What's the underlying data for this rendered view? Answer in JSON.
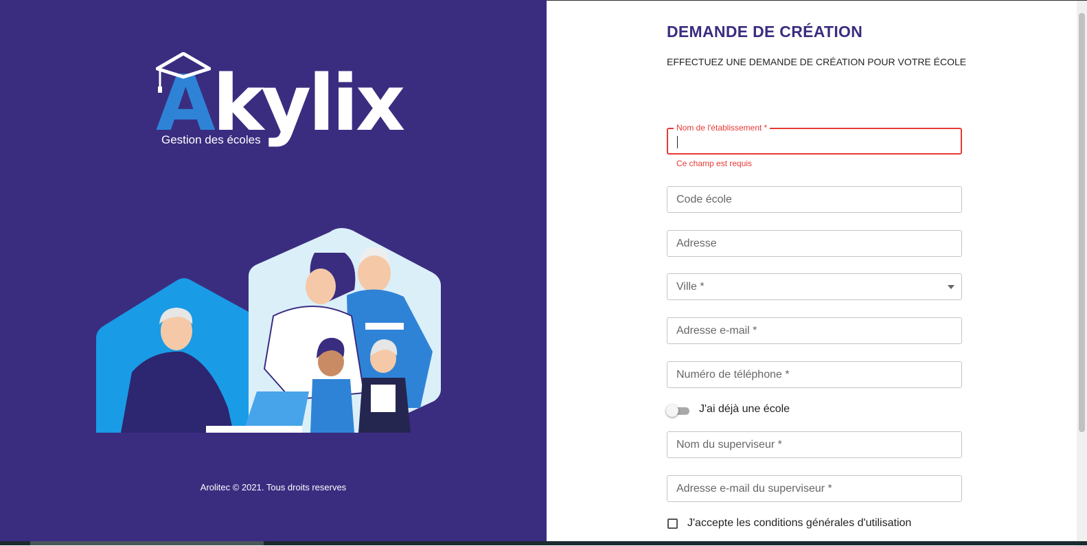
{
  "brand": {
    "name_first_letter": "A",
    "name_rest": "kylix",
    "tagline": "Gestion des écoles",
    "footer": "Arolitec © 2021. Tous droits reserves"
  },
  "form": {
    "title": "DEMANDE DE CRÉATION",
    "subtitle": "EFFECTUEZ UNE DEMANDE DE CRÉATION POUR VOTRE ÉCOLE",
    "fields": {
      "school_name_label": "Nom de l'établissement *",
      "school_name_error": "Ce champ est requis",
      "school_code_placeholder": "Code école",
      "address_placeholder": "Adresse",
      "city_placeholder": "Ville *",
      "email_placeholder": "Adresse e-mail *",
      "phone_placeholder": "Numéro de téléphone *",
      "supervisor_name_placeholder": "Nom du superviseur *",
      "supervisor_email_placeholder": "Adresse e-mail du superviseur *"
    },
    "toggle_label": "J'ai déjà une école",
    "toggle_on": false,
    "terms_label": "J'accepte les conditions générales d'utilisation",
    "terms_checked": false
  },
  "colors": {
    "primary": "#3a2d80",
    "accent_blue": "#2f83d6",
    "error": "#e53935"
  }
}
